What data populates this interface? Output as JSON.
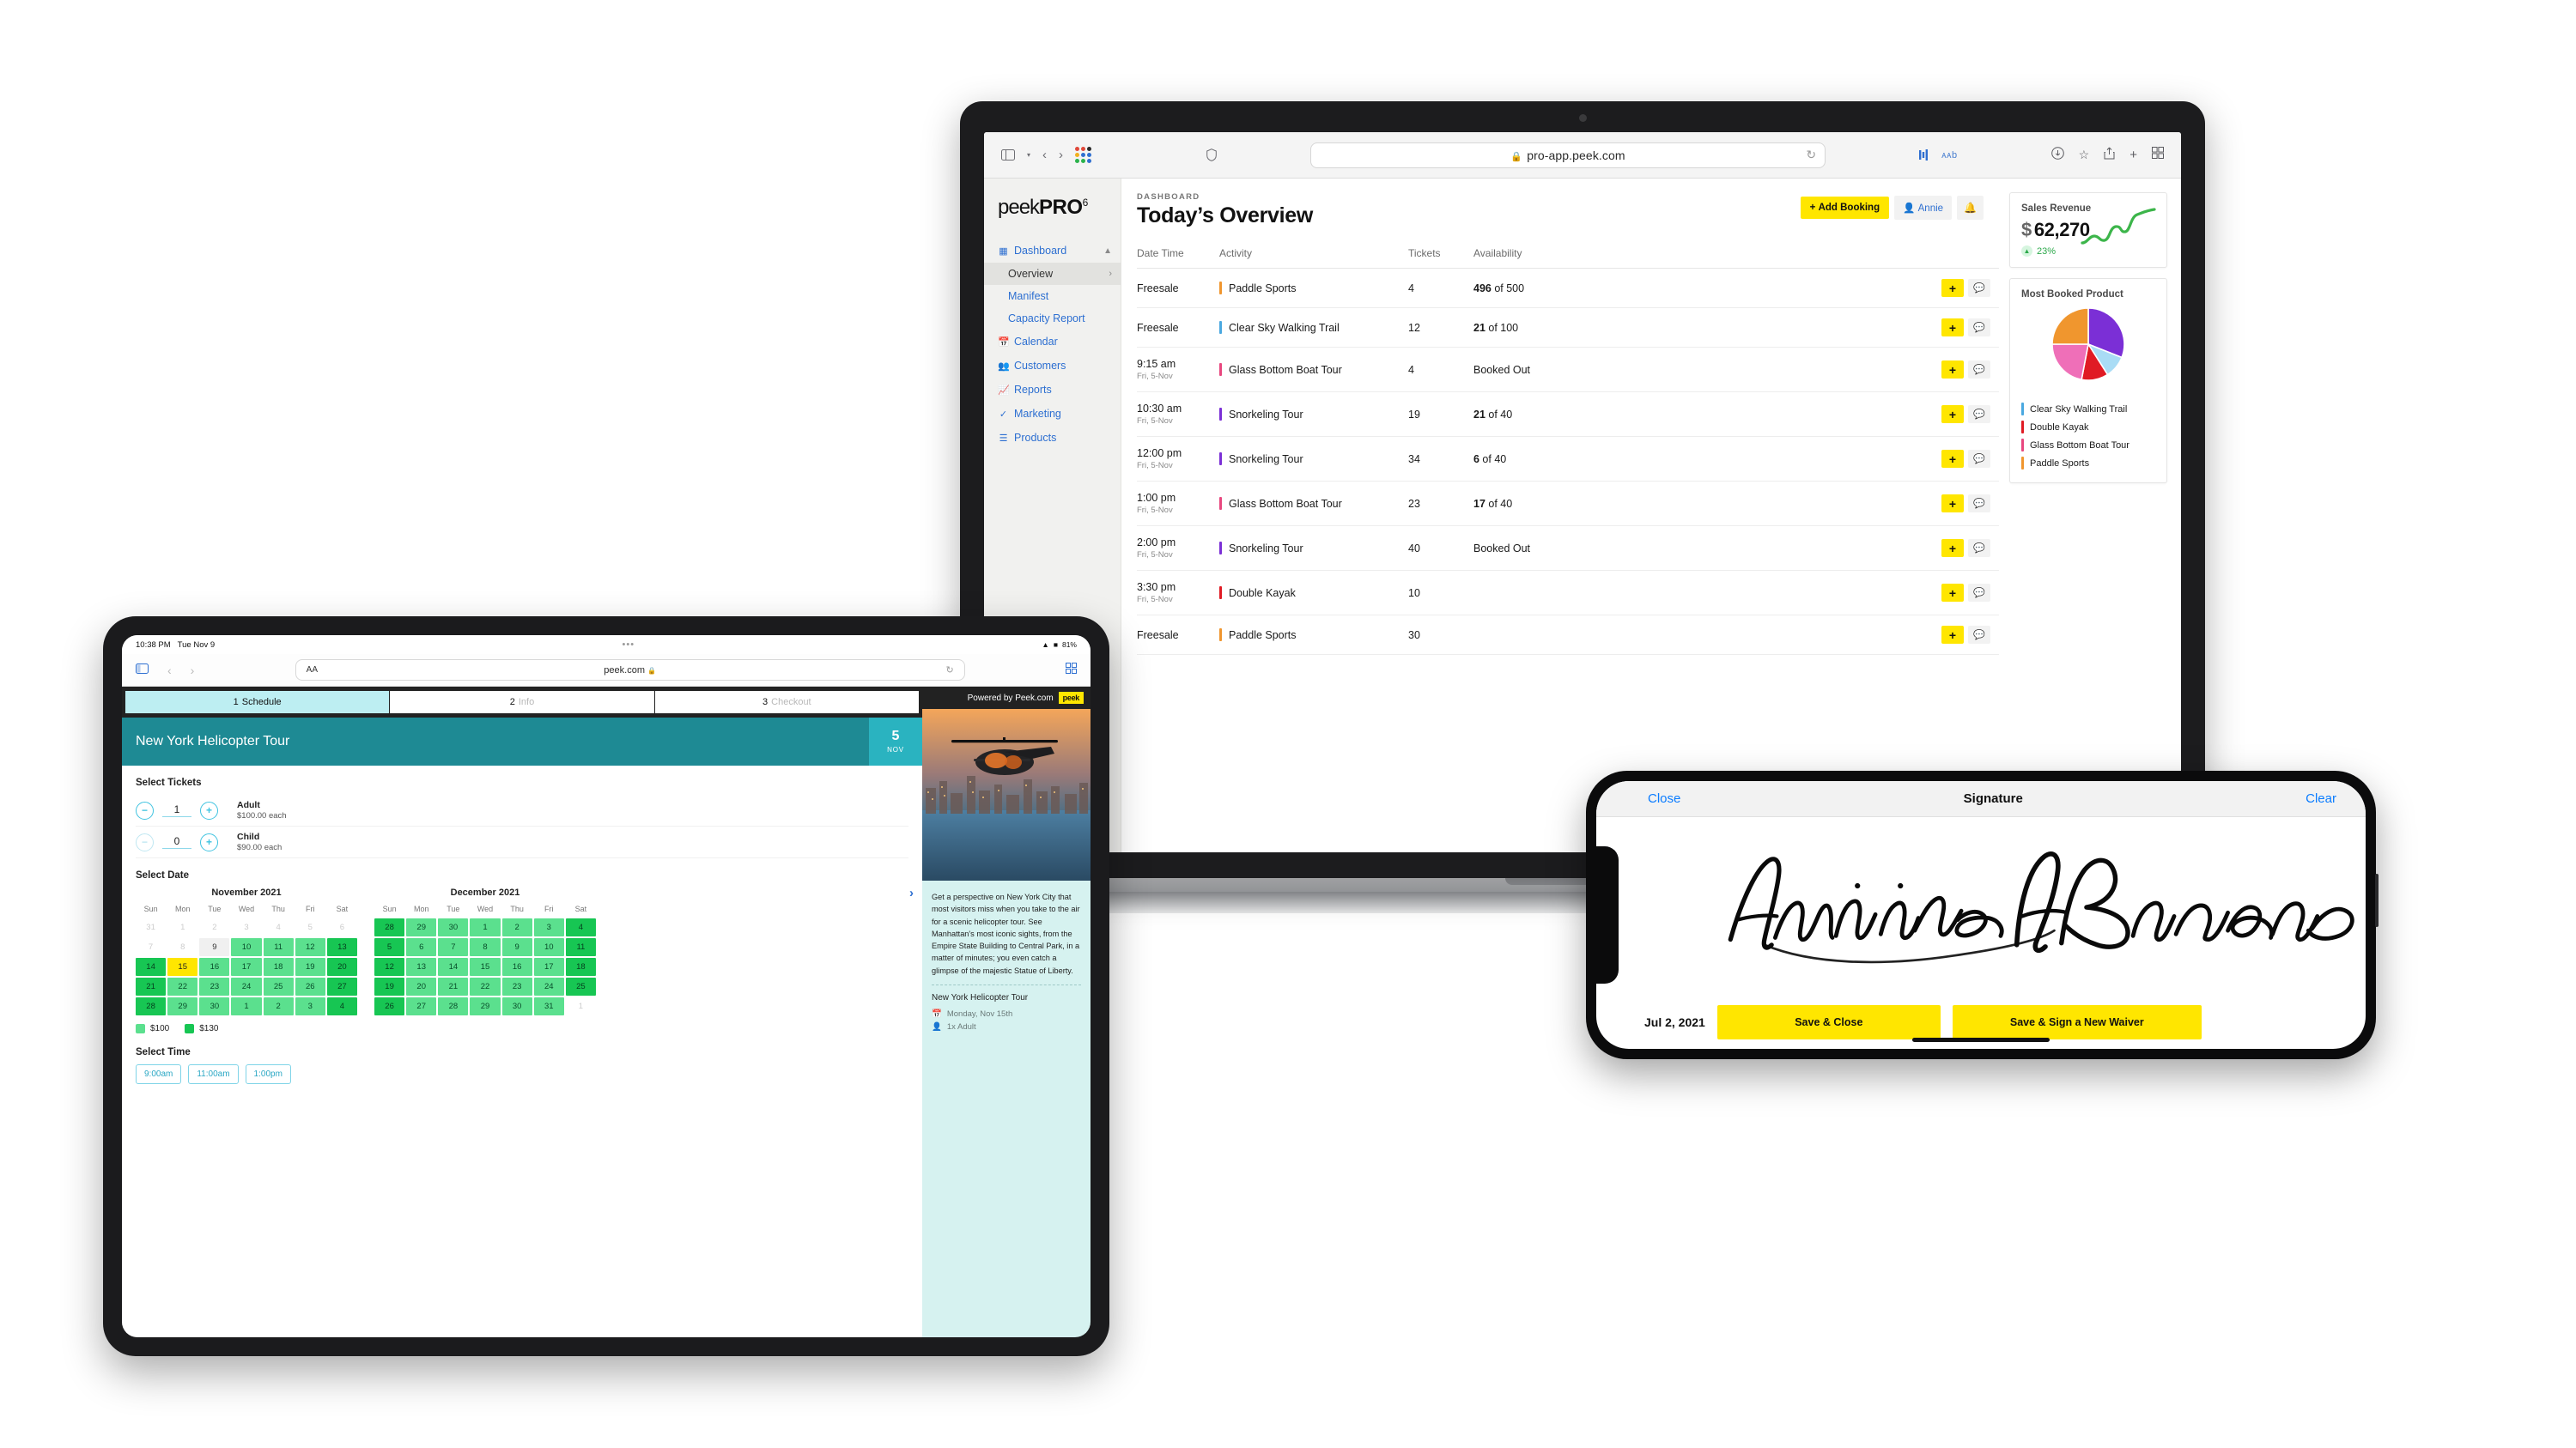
{
  "laptop": {
    "browser": {
      "url": "pro-app.peek.com",
      "lock_icon": "lock-icon",
      "reload_icon": "reload-icon",
      "sidebar_icon": "sidebar-toggle-icon",
      "back_icon": "back-arrow-icon",
      "forward_icon": "forward-arrow-icon",
      "apps_icon": "apps-grid-icon",
      "shield_icon": "shield-icon",
      "reader_icon": "reader-view-icon",
      "text_size_label": "ᴀᴀb",
      "downloads_icon": "downloads-icon",
      "bookmark_icon": "star-icon",
      "share_icon": "share-icon",
      "newtab_icon": "plus-icon",
      "tabs_icon": "tab-overview-icon"
    },
    "logo": {
      "text": "peek",
      "bold": "PRO",
      "sup": "6"
    },
    "sidebar": {
      "items": [
        {
          "label": "Dashboard",
          "icon": "dashboard-icon",
          "expanded": true
        },
        {
          "label": "Calendar",
          "icon": "calendar-icon"
        },
        {
          "label": "Customers",
          "icon": "customers-icon"
        },
        {
          "label": "Reports",
          "icon": "reports-icon"
        },
        {
          "label": "Marketing",
          "icon": "marketing-icon"
        },
        {
          "label": "Products",
          "icon": "products-icon"
        }
      ],
      "sub_items": [
        {
          "label": "Overview",
          "active": true
        },
        {
          "label": "Manifest",
          "active": false
        },
        {
          "label": "Capacity Report",
          "active": false
        }
      ]
    },
    "header": {
      "eyebrow": "DASHBOARD",
      "title": "Today’s Overview",
      "add_booking": "Add Booking",
      "user": "Annie",
      "bell_icon": "bell-icon"
    },
    "table": {
      "columns": [
        "Date Time",
        "Activity",
        "Tickets",
        "Availability"
      ],
      "rows": [
        {
          "time": "Freesale",
          "date": "",
          "activity": "Paddle Sports",
          "color": "#f0962e",
          "tickets": "4",
          "avail_num": "496",
          "avail_rest": " of 500",
          "booked_out": false
        },
        {
          "time": "Freesale",
          "date": "",
          "activity": "Clear Sky Walking Trail",
          "color": "#4aa8e0",
          "tickets": "12",
          "avail_num": "21",
          "avail_rest": " of 100",
          "booked_out": false
        },
        {
          "time": "9:15 am",
          "date": "Fri, 5-Nov",
          "activity": "Glass Bottom Boat Tour",
          "color": "#e8477f",
          "tickets": "4",
          "avail_num": "",
          "avail_rest": "Booked Out",
          "booked_out": true
        },
        {
          "time": "10:30 am",
          "date": "Fri, 5-Nov",
          "activity": "Snorkeling Tour",
          "color": "#7b2fd6",
          "tickets": "19",
          "avail_num": "21",
          "avail_rest": " of 40",
          "booked_out": false
        },
        {
          "time": "12:00 pm",
          "date": "Fri, 5-Nov",
          "activity": "Snorkeling Tour",
          "color": "#7b2fd6",
          "tickets": "34",
          "avail_num": "6",
          "avail_rest": " of 40",
          "booked_out": false
        },
        {
          "time": "1:00 pm",
          "date": "Fri, 5-Nov",
          "activity": "Glass Bottom Boat Tour",
          "color": "#e8477f",
          "tickets": "23",
          "avail_num": "17",
          "avail_rest": " of 40",
          "booked_out": false
        },
        {
          "time": "2:00 pm",
          "date": "Fri, 5-Nov",
          "activity": "Snorkeling Tour",
          "color": "#7b2fd6",
          "tickets": "40",
          "avail_num": "",
          "avail_rest": "Booked Out",
          "booked_out": true
        },
        {
          "time": "3:30 pm",
          "date": "Fri, 5-Nov",
          "activity": "Double Kayak",
          "color": "#e01b24",
          "tickets": "10",
          "avail_num": "",
          "avail_rest": "",
          "booked_out": false
        },
        {
          "time": "Freesale",
          "date": "",
          "activity": "Paddle Sports",
          "color": "#f0962e",
          "tickets": "30",
          "avail_num": "",
          "avail_rest": "",
          "booked_out": false
        }
      ],
      "add_icon": "plus-icon",
      "chat_icon": "chat-bubble-icon"
    },
    "cards": {
      "revenue": {
        "title": "Sales Revenue",
        "currency": "$",
        "amount": "62,270",
        "change": "23%",
        "change_color": "#2ba84a",
        "arrow_icon": "arrow-up-icon"
      },
      "product": {
        "title": "Most Booked Product",
        "legend": [
          {
            "label": "Clear Sky Walking Trail",
            "color": "#4aa8e0"
          },
          {
            "label": "Double Kayak",
            "color": "#e01b24"
          },
          {
            "label": "Glass Bottom Boat Tour",
            "color": "#e8477f"
          },
          {
            "label": "Paddle Sports",
            "color": "#f0962e"
          }
        ]
      }
    },
    "chart_data": [
      {
        "type": "line",
        "title": "Sales Revenue",
        "x": [
          0,
          1,
          2,
          3,
          4,
          5,
          6,
          7,
          8
        ],
        "values": [
          10,
          16,
          24,
          19,
          26,
          40,
          34,
          44,
          62
        ],
        "series_color": "#3cb54a",
        "grid": false,
        "legend": "none",
        "xlabel": "",
        "ylabel": ""
      },
      {
        "type": "pie",
        "title": "Most Booked Product",
        "categories": [
          "Snorkeling Tour",
          "Clear Sky Walking Trail",
          "Double Kayak",
          "Glass Bottom Boat Tour",
          "Paddle Sports"
        ],
        "values": [
          31,
          10,
          12,
          22,
          25
        ],
        "colors": [
          "#7b2fd6",
          "#a9dcf5",
          "#e01b24",
          "#ef6fb8",
          "#f0962e"
        ],
        "legend": "bottom"
      }
    ]
  },
  "tablet": {
    "status": {
      "time": "10:38 PM",
      "date": "Tue Nov 9",
      "dots": "•••",
      "wifi_icon": "wifi-icon",
      "battery": "81%"
    },
    "browser": {
      "url": "peek.com",
      "text_size": "AA",
      "lock_icon": "lock-icon",
      "reload_icon": "reload-icon",
      "sidebar_icon": "sidebar-toggle-icon",
      "back_icon": "back-arrow-icon",
      "forward_icon": "forward-arrow-icon",
      "tabs_icon": "tab-overview-icon"
    },
    "steps": [
      {
        "num": "1",
        "label": "Schedule",
        "active": true
      },
      {
        "num": "2",
        "label": "Info",
        "active": false
      },
      {
        "num": "3",
        "label": "Checkout",
        "active": false
      }
    ],
    "header": {
      "title": "New York Helicopter Tour",
      "day": "5",
      "month": "NOV"
    },
    "tickets": {
      "heading": "Select Tickets",
      "rows": [
        {
          "qty": "1",
          "name": "Adult",
          "price": "$100.00 each",
          "minus_enabled": true
        },
        {
          "qty": "0",
          "name": "Child",
          "price": "$90.00 each",
          "minus_enabled": false
        }
      ],
      "minus_icon": "minus-icon",
      "plus_icon": "plus-icon"
    },
    "date_section": {
      "heading": "Select Date",
      "next_icon": "chevron-right-icon",
      "dow": [
        "Sun",
        "Mon",
        "Tue",
        "Wed",
        "Thu",
        "Fri",
        "Sat"
      ],
      "months": [
        {
          "title": "November 2021",
          "days": [
            {
              "n": "31",
              "s": "off"
            },
            {
              "n": "1",
              "s": "off"
            },
            {
              "n": "2",
              "s": "off"
            },
            {
              "n": "3",
              "s": "off"
            },
            {
              "n": "4",
              "s": "off"
            },
            {
              "n": "5",
              "s": "off"
            },
            {
              "n": "6",
              "s": "off"
            },
            {
              "n": "7",
              "s": "off"
            },
            {
              "n": "8",
              "s": "off"
            },
            {
              "n": "9",
              "s": "today"
            },
            {
              "n": "10",
              "s": "a"
            },
            {
              "n": "11",
              "s": "a"
            },
            {
              "n": "12",
              "s": "a"
            },
            {
              "n": "13",
              "s": "b"
            },
            {
              "n": "14",
              "s": "b"
            },
            {
              "n": "15",
              "s": "sel"
            },
            {
              "n": "16",
              "s": "a"
            },
            {
              "n": "17",
              "s": "a"
            },
            {
              "n": "18",
              "s": "a"
            },
            {
              "n": "19",
              "s": "a"
            },
            {
              "n": "20",
              "s": "b"
            },
            {
              "n": "21",
              "s": "b"
            },
            {
              "n": "22",
              "s": "a"
            },
            {
              "n": "23",
              "s": "a"
            },
            {
              "n": "24",
              "s": "a"
            },
            {
              "n": "25",
              "s": "a"
            },
            {
              "n": "26",
              "s": "a"
            },
            {
              "n": "27",
              "s": "b"
            },
            {
              "n": "28",
              "s": "b"
            },
            {
              "n": "29",
              "s": "a"
            },
            {
              "n": "30",
              "s": "a"
            },
            {
              "n": "1",
              "s": "a"
            },
            {
              "n": "2",
              "s": "a"
            },
            {
              "n": "3",
              "s": "a"
            },
            {
              "n": "4",
              "s": "b"
            }
          ]
        },
        {
          "title": "December 2021",
          "days": [
            {
              "n": "28",
              "s": "b"
            },
            {
              "n": "29",
              "s": "a"
            },
            {
              "n": "30",
              "s": "a"
            },
            {
              "n": "1",
              "s": "a"
            },
            {
              "n": "2",
              "s": "a"
            },
            {
              "n": "3",
              "s": "a"
            },
            {
              "n": "4",
              "s": "b"
            },
            {
              "n": "5",
              "s": "b"
            },
            {
              "n": "6",
              "s": "a"
            },
            {
              "n": "7",
              "s": "a"
            },
            {
              "n": "8",
              "s": "a"
            },
            {
              "n": "9",
              "s": "a"
            },
            {
              "n": "10",
              "s": "a"
            },
            {
              "n": "11",
              "s": "b"
            },
            {
              "n": "12",
              "s": "b"
            },
            {
              "n": "13",
              "s": "a"
            },
            {
              "n": "14",
              "s": "a"
            },
            {
              "n": "15",
              "s": "a"
            },
            {
              "n": "16",
              "s": "a"
            },
            {
              "n": "17",
              "s": "a"
            },
            {
              "n": "18",
              "s": "b"
            },
            {
              "n": "19",
              "s": "b"
            },
            {
              "n": "20",
              "s": "a"
            },
            {
              "n": "21",
              "s": "a"
            },
            {
              "n": "22",
              "s": "a"
            },
            {
              "n": "23",
              "s": "a"
            },
            {
              "n": "24",
              "s": "a"
            },
            {
              "n": "25",
              "s": "b"
            },
            {
              "n": "26",
              "s": "b"
            },
            {
              "n": "27",
              "s": "a"
            },
            {
              "n": "28",
              "s": "a"
            },
            {
              "n": "29",
              "s": "a"
            },
            {
              "n": "30",
              "s": "a"
            },
            {
              "n": "31",
              "s": "a"
            },
            {
              "n": "1",
              "s": "off"
            }
          ]
        }
      ],
      "price_legend": [
        {
          "label": "$100",
          "color": "#5be08e"
        },
        {
          "label": "$130",
          "color": "#17c653"
        }
      ]
    },
    "time_section": {
      "heading": "Select Time",
      "times": [
        "9:00am",
        "11:00am",
        "1:00pm"
      ]
    },
    "right": {
      "powered_by": "Powered by Peek.com",
      "chip": "peek",
      "description": "Get a perspective on New York City that most visitors miss when you take to the air for a scenic helicopter tour. See Manhattan's most iconic sights, from the Empire State Building to Central Park, in a matter of minutes; you even catch a glimpse of the majestic Statue of Liberty.",
      "summary_title": "New York Helicopter Tour",
      "summary_date": "Monday, Nov 15th",
      "summary_guests": "1x Adult",
      "calendar_icon": "calendar-icon",
      "person_icon": "person-icon"
    }
  },
  "phone": {
    "close": "Close",
    "title": "Signature",
    "clear": "Clear",
    "date": "Jul 2, 2021",
    "save_close": "Save & Close",
    "save_new_waiver": "Save & Sign a New Waiver",
    "signature_name": "Annie Benson"
  }
}
